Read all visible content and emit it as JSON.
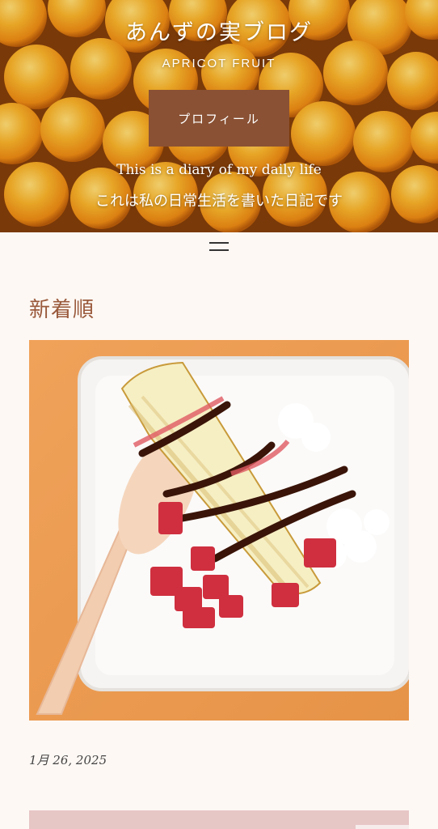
{
  "header": {
    "title": "あんずの実ブログ",
    "subtitle": "APRICOT FRUIT",
    "profile_button": "プロフィール",
    "tagline_en": "This is a diary of my daily life",
    "tagline_ja": "これは私の日常生活を書いた日記です"
  },
  "nav": {
    "menu_icon": "hamburger-menu-icon"
  },
  "main": {
    "section_title": "新着順",
    "posts": [
      {
        "image": "baumkuchen-with-strawberries-and-cream-photo",
        "date": "1月 26, 2025"
      },
      {
        "image": "next-post-thumbnail-photo"
      }
    ]
  },
  "colors": {
    "background": "#fdf8f4",
    "accent": "#8a5134",
    "heading": "#9a5a3c"
  }
}
